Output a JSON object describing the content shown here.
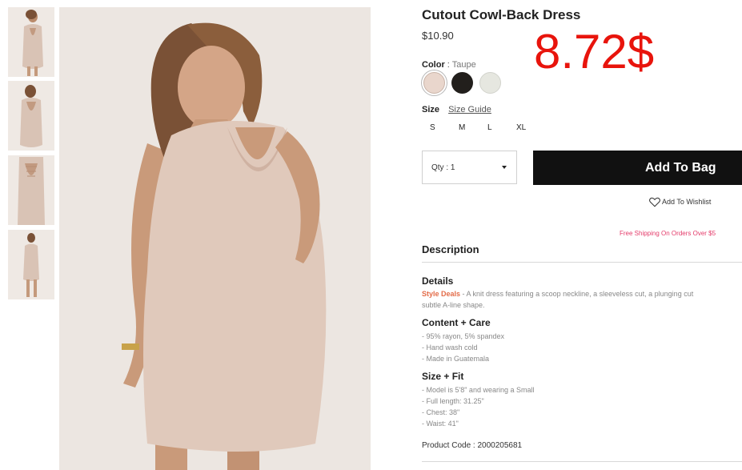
{
  "product": {
    "title": "Cutout Cowl-Back Dress",
    "price": "$10.90",
    "sale_price": "8.72$"
  },
  "color": {
    "label": "Color",
    "separator": ":",
    "selected": "Taupe",
    "swatches": [
      {
        "name": "Taupe",
        "hex": "#e9d6cc"
      },
      {
        "name": "Black",
        "hex": "#221f1c"
      },
      {
        "name": "Cream",
        "hex": "#e6e7e0"
      }
    ]
  },
  "size": {
    "label": "Size",
    "guide_label": "Size Guide",
    "options": [
      "S",
      "M",
      "L",
      "XL"
    ]
  },
  "quantity": {
    "label": "Qty : 1"
  },
  "actions": {
    "add_to_bag": "Add To Bag",
    "wishlist": "Add To Wishlist"
  },
  "shipping_note": "Free Shipping On Orders Over $5",
  "description": {
    "heading": "Description",
    "details_heading": "Details",
    "details_brand": "Style Deals",
    "details_text": " - A knit dress featuring a scoop neckline, a sleeveless cut, a plunging cut",
    "details_text_2": "subtle A-line shape.",
    "content_heading": "Content + Care",
    "content_lines": [
      "- 95% rayon, 5% spandex",
      "- Hand wash cold",
      "- Made in Guatemala"
    ],
    "fit_heading": "Size + Fit",
    "fit_lines": [
      "- Model is 5'8\" and wearing a Small",
      "- Full length: 31.25\"",
      "- Chest: 38\"",
      "- Waist: 41\""
    ],
    "product_code": "Product Code : 2000205681"
  },
  "colors": {
    "sale_red": "#e8140c",
    "shipping_pink": "#e43b6a",
    "deal_orange": "#e36c49",
    "button_black": "#111111"
  },
  "icons": {
    "wishlist": "heart-icon",
    "quantity": "chevron-down-icon"
  }
}
